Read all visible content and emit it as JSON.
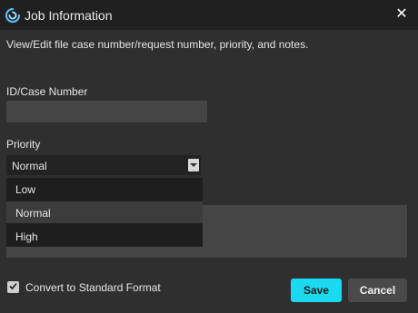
{
  "window": {
    "title": "Job Information",
    "close_glyph": "✕",
    "icon": "app-logo-icon"
  },
  "description": "View/Edit file case number/request number, priority, and notes.",
  "case_number": {
    "label": "ID/Case Number",
    "value": "",
    "placeholder": ""
  },
  "priority": {
    "label": "Priority",
    "selected": "Normal",
    "options": [
      {
        "label": "Low",
        "selected": false
      },
      {
        "label": "Normal",
        "selected": true
      },
      {
        "label": "High",
        "selected": false
      }
    ]
  },
  "convert": {
    "label": "Convert to Standard Format",
    "checked": true
  },
  "buttons": {
    "save": "Save",
    "cancel": "Cancel"
  },
  "colors": {
    "accent": "#1ad9f0",
    "background": "#2f2f2f",
    "titlebar": "#202020"
  }
}
